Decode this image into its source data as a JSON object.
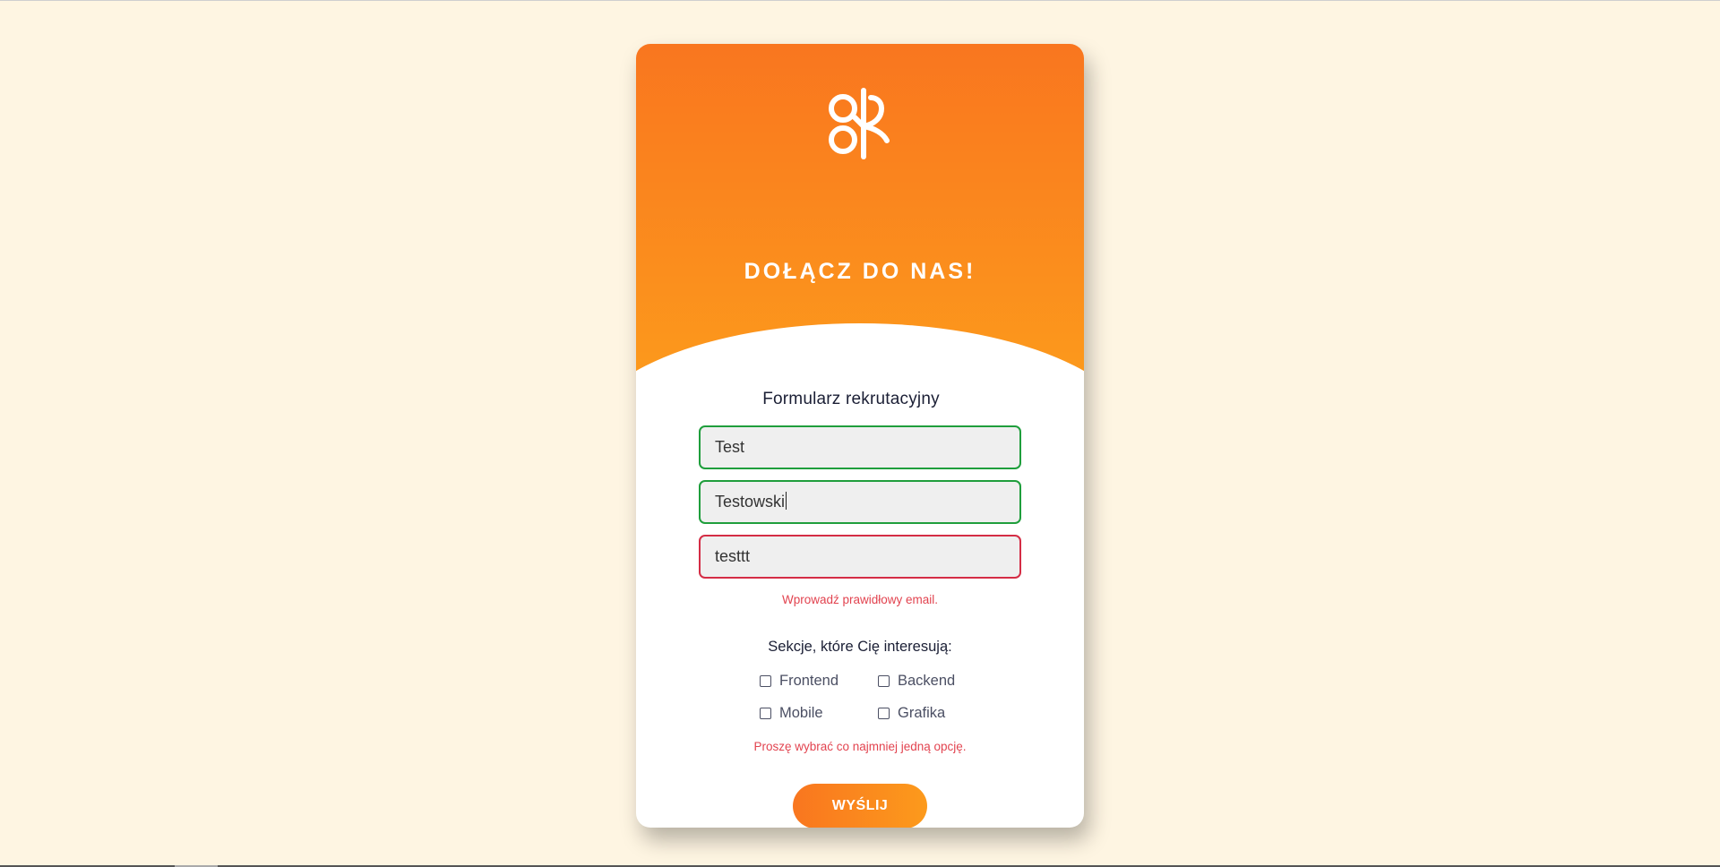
{
  "header": {
    "logo_icon": "ak-logo-icon",
    "title": "DOŁĄCZ DO NAS!"
  },
  "form": {
    "title": "Formularz rekrutacyjny",
    "fields": [
      {
        "value": "Test",
        "state": "valid"
      },
      {
        "value": "Testowski",
        "state": "valid",
        "focused": true
      },
      {
        "value": "testtt",
        "state": "invalid"
      }
    ],
    "email_error": "Wprowadź prawidłowy email.",
    "sections": {
      "title": "Sekcje, które Cię interesują:",
      "options": [
        {
          "label": "Frontend",
          "checked": false
        },
        {
          "label": "Backend",
          "checked": false
        },
        {
          "label": "Mobile",
          "checked": false
        },
        {
          "label": "Grafika",
          "checked": false
        }
      ],
      "error": "Proszę wybrać co najmniej jedną opcję."
    },
    "submit_label": "WYŚLIJ"
  },
  "colors": {
    "background": "#fef5e2",
    "accent_start": "#f9761f",
    "accent_end": "#fc9a1c",
    "valid": "#1f9e3c",
    "invalid": "#d42d45",
    "error_text": "#e2434f"
  }
}
